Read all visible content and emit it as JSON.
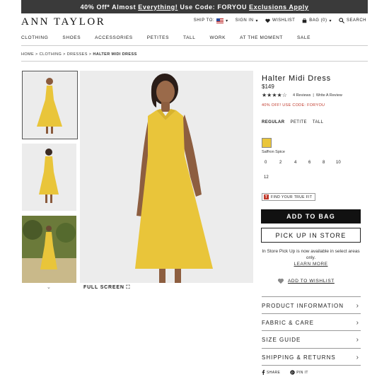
{
  "promo": {
    "part1": "40% Off* Almost",
    "part2": "Everything!",
    "part3": "Use Code: FORYOU",
    "part4": "Exclusions Apply"
  },
  "header": {
    "logo": "ANN TAYLOR",
    "ship_to": "SHIP TO:",
    "sign_in": "SIGN IN",
    "wishlist": "WISHLIST",
    "bag": "BAG (0)",
    "search": "SEARCH"
  },
  "nav": [
    "CLOTHING",
    "SHOES",
    "ACCESSORIES",
    "PETITES",
    "TALL",
    "WORK",
    "AT THE MOMENT",
    "SALE"
  ],
  "breadcrumb": {
    "home": "HOME",
    "clothing": "CLOTHING",
    "dresses": "DRESSES",
    "current": "HALTER MIDI DRESS",
    "sep": ">"
  },
  "gallery": {
    "fullscreen": "FULL SCREEN",
    "fullscreen_icon": "⛶",
    "down_icon": "⌄"
  },
  "product": {
    "title": "Halter Midi Dress",
    "price": "$149",
    "rating": 3.5,
    "rating_stars": "★★★★☆",
    "reviews": "4 Reviews",
    "write_review": "Write A Review",
    "promo_line": "40% OFF! USE CODE: FORYOU",
    "size_types": [
      "REGULAR",
      "PETITE",
      "TALL"
    ],
    "color_name": "Saffron Spice",
    "color_hex": "#e9c53a",
    "sizes": [
      "0",
      "2",
      "4",
      "6",
      "8",
      "10",
      "12"
    ],
    "fit_label": "FIND YOUR TRUE FIT",
    "fit_icon_letter": "T",
    "add_to_bag": "ADD TO BAG",
    "pick_up": "PICK UP IN STORE",
    "pickup_note": "In Store Pick Up is now available in select areas only.",
    "learn_more": "LEARN MORE",
    "add_wishlist": "ADD TO WISHLIST"
  },
  "accordion": [
    "PRODUCT INFORMATION",
    "FABRIC & CARE",
    "SIZE GUIDE",
    "SHIPPING & RETURNS"
  ],
  "share": {
    "share": "SHARE",
    "pin": "PIN IT"
  }
}
